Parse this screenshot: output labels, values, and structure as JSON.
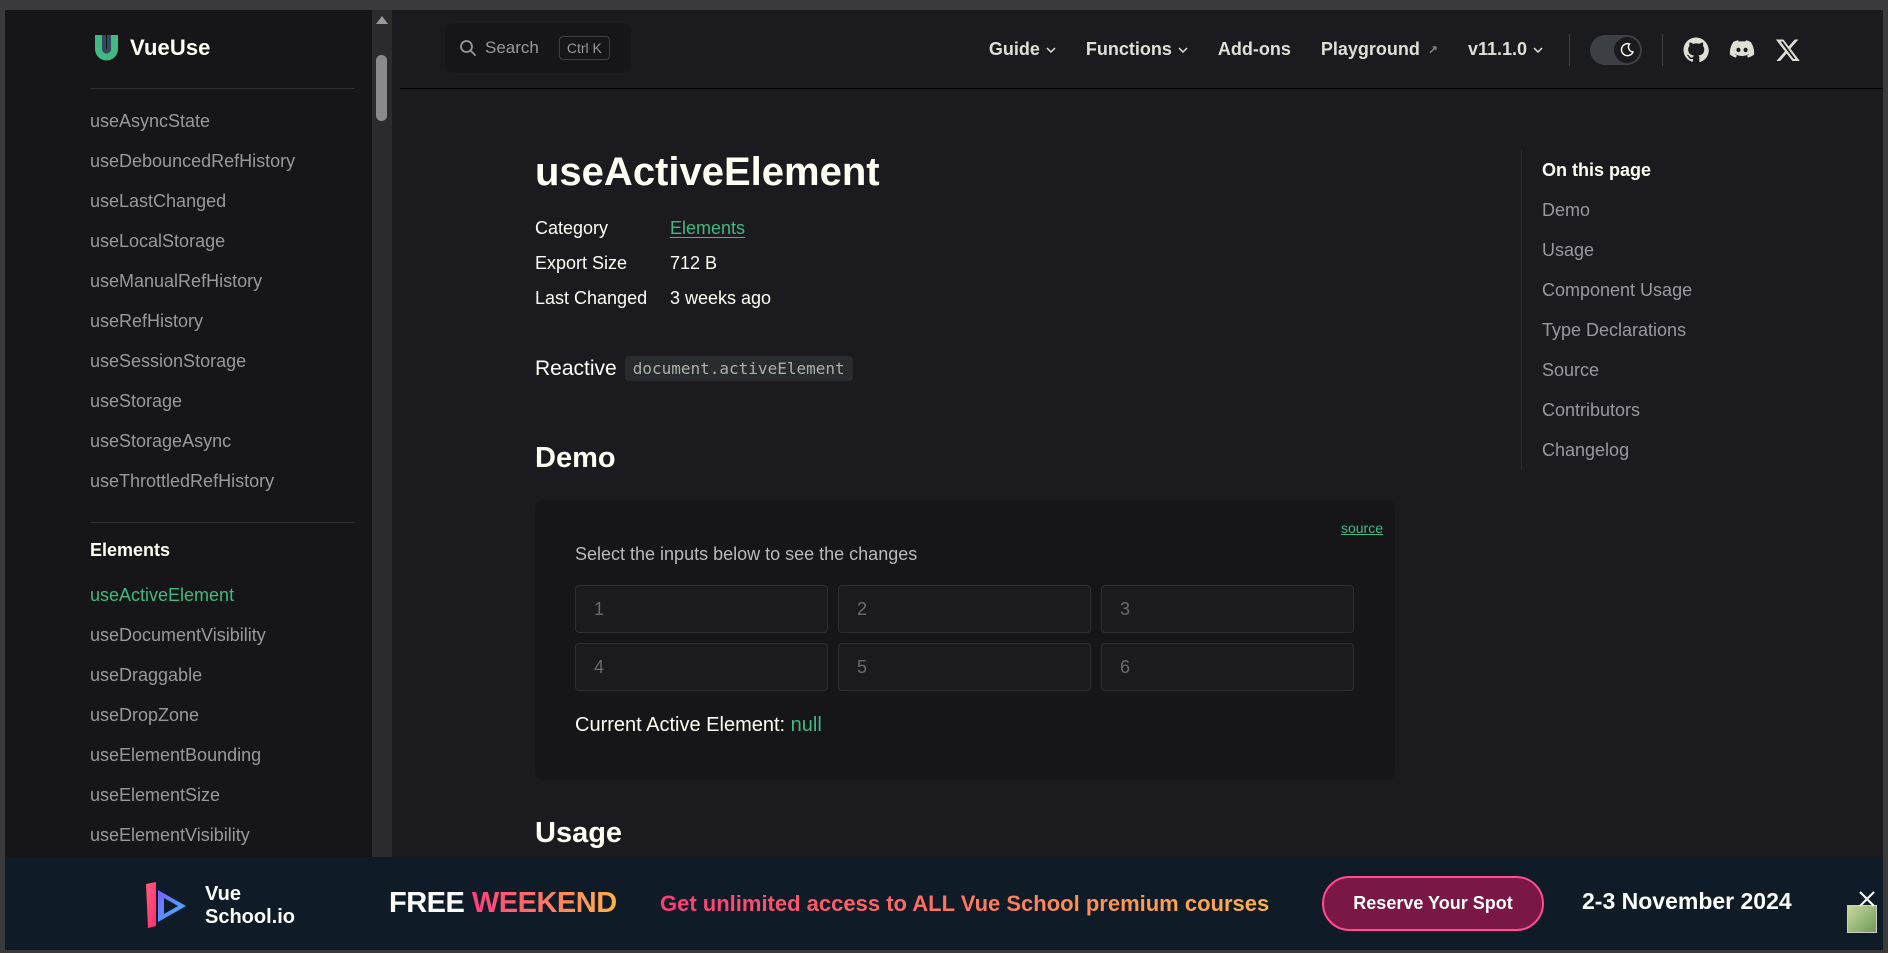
{
  "brand": {
    "name": "VueUse"
  },
  "sidebar": {
    "group1_items": [
      "useAsyncState",
      "useDebouncedRefHistory",
      "useLastChanged",
      "useLocalStorage",
      "useManualRefHistory",
      "useRefHistory",
      "useSessionStorage",
      "useStorage",
      "useStorageAsync",
      "useThrottledRefHistory"
    ],
    "group2_title": "Elements",
    "group2_items": [
      "useActiveElement",
      "useDocumentVisibility",
      "useDraggable",
      "useDropZone",
      "useElementBounding",
      "useElementSize",
      "useElementVisibility"
    ],
    "active_item": "useActiveElement"
  },
  "topbar": {
    "search_label": "Search",
    "search_shortcut": "Ctrl K",
    "nav": [
      {
        "label": "Guide",
        "dropdown": true
      },
      {
        "label": "Functions",
        "dropdown": true
      },
      {
        "label": "Add-ons",
        "dropdown": false
      },
      {
        "label": "Playground",
        "external": true
      },
      {
        "label": "v11.1.0",
        "dropdown": true
      }
    ],
    "theme_toggle_icon": "moon-icon",
    "social_icons": [
      "github-icon",
      "discord-icon",
      "x-icon"
    ]
  },
  "main": {
    "title": "useActiveElement",
    "meta": [
      {
        "key": "Category",
        "value": "Elements",
        "link": true
      },
      {
        "key": "Export Size",
        "value": "712 B",
        "link": false
      },
      {
        "key": "Last Changed",
        "value": "3 weeks ago",
        "link": false
      }
    ],
    "intro_text": "Reactive",
    "intro_code": "document.activeElement",
    "demo_heading": "Demo",
    "demo": {
      "source_label": "source",
      "hint": "Select the inputs below to see the changes",
      "inputs": [
        "1",
        "2",
        "3",
        "4",
        "5",
        "6"
      ],
      "current_label": "Current Active Element:",
      "current_value": "null"
    },
    "usage_heading": "Usage"
  },
  "toc": {
    "title": "On this page",
    "items": [
      "Demo",
      "Usage",
      "Component Usage",
      "Type Declarations",
      "Source",
      "Contributors",
      "Changelog"
    ]
  },
  "banner": {
    "logo_line1": "Vue",
    "logo_line2": "School.io",
    "free_word": "FREE",
    "weekend_word": "WEEKEND",
    "promo": "Get unlimited access to ALL Vue School premium courses",
    "cta": "Reserve Your Spot",
    "date": "2-3 November 2024"
  },
  "colors": {
    "accent": "#42b883",
    "background": "#1b1b1f",
    "sidebar_bg": "#161618",
    "banner_bg": "#0f1b27",
    "cta_border": "#ff4d8d"
  }
}
